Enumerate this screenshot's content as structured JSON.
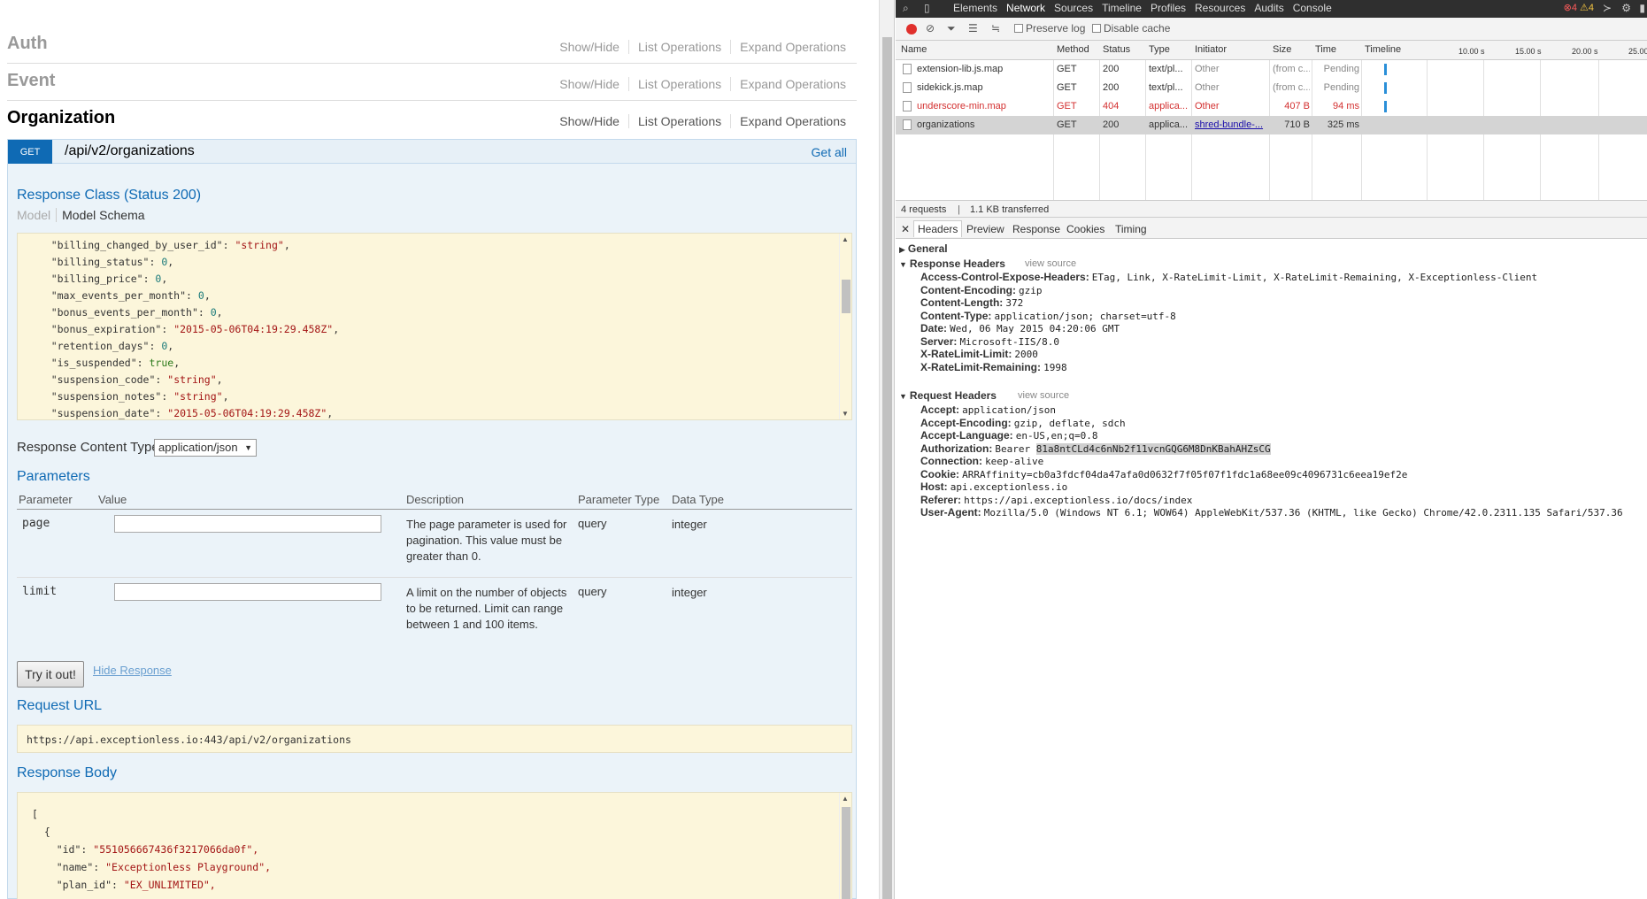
{
  "swagger": {
    "resources": [
      {
        "name": "Auth",
        "ops": [
          "Show/Hide",
          "List Operations",
          "Expand Operations"
        ]
      },
      {
        "name": "Event",
        "ops": [
          "Show/Hide",
          "List Operations",
          "Expand Operations"
        ]
      },
      {
        "name": "Organization",
        "ops": [
          "Show/Hide",
          "List Operations",
          "Expand Operations"
        ]
      }
    ],
    "operation": {
      "method": "GET",
      "path": "/api/v2/organizations",
      "summary": "Get all"
    },
    "response_class_title": "Response Class (Status 200)",
    "model_tabs": [
      "Model",
      "Model Schema"
    ],
    "schema_lines": [
      {
        "key": "\"billing_changed_by_user_id\"",
        "value": "\"string\"",
        "type": "str"
      },
      {
        "key": "\"billing_status\"",
        "value": "0",
        "type": "num"
      },
      {
        "key": "\"billing_price\"",
        "value": "0",
        "type": "num"
      },
      {
        "key": "\"max_events_per_month\"",
        "value": "0",
        "type": "num"
      },
      {
        "key": "\"bonus_events_per_month\"",
        "value": "0",
        "type": "num"
      },
      {
        "key": "\"bonus_expiration\"",
        "value": "\"2015-05-06T04:19:29.458Z\"",
        "type": "str"
      },
      {
        "key": "\"retention_days\"",
        "value": "0",
        "type": "num"
      },
      {
        "key": "\"is_suspended\"",
        "value": "true",
        "type": "bool"
      },
      {
        "key": "\"suspension_code\"",
        "value": "\"string\"",
        "type": "str"
      },
      {
        "key": "\"suspension_notes\"",
        "value": "\"string\"",
        "type": "str"
      },
      {
        "key": "\"suspension_date\"",
        "value": "\"2015-05-06T04:19:29.458Z\"",
        "type": "str"
      }
    ],
    "response_content_type_label": "Response Content Type",
    "response_content_type_value": "application/json",
    "parameters_title": "Parameters",
    "param_headers": [
      "Parameter",
      "Value",
      "Description",
      "Parameter Type",
      "Data Type"
    ],
    "params": [
      {
        "name": "page",
        "value": "",
        "description": "The page parameter is used for pagination. This value must be greater than 0.",
        "param_type": "query",
        "data_type": "integer"
      },
      {
        "name": "limit",
        "value": "",
        "description": "A limit on the number of objects to be returned. Limit can range between 1 and 100 items.",
        "param_type": "query",
        "data_type": "integer"
      }
    ],
    "try_button": "Try it out!",
    "hide_response": "Hide Response",
    "request_url_title": "Request URL",
    "request_url": "https://api.exceptionless.io:443/api/v2/organizations",
    "response_body_title": "Response Body",
    "response_body_lines": [
      {
        "indent": 0,
        "text": "["
      },
      {
        "indent": 1,
        "text": "{"
      },
      {
        "indent": 2,
        "key": "\"id\"",
        "value": "\"551056667436f3217066da0f\","
      },
      {
        "indent": 2,
        "key": "\"name\"",
        "value": "\"Exceptionless Playground\","
      },
      {
        "indent": 2,
        "key": "\"plan_id\"",
        "value": "\"EX_UNLIMITED\","
      }
    ]
  },
  "devtools": {
    "tabs": [
      "Elements",
      "Network",
      "Sources",
      "Timeline",
      "Profiles",
      "Resources",
      "Audits",
      "Console"
    ],
    "error_count": "4",
    "warning_count": "4",
    "toolbar": {
      "preserve_log": "Preserve log",
      "disable_cache": "Disable cache"
    },
    "columns": [
      "Name",
      "Method",
      "Status",
      "Type",
      "Initiator",
      "Size",
      "Time",
      "Timeline"
    ],
    "timeline_ticks": [
      "10.00 s",
      "15.00 s",
      "20.00 s",
      "25.00"
    ],
    "requests": [
      {
        "name": "extension-lib.js.map",
        "method": "GET",
        "status": "200",
        "type": "text/pl...",
        "initiator": "Other",
        "size": "(from c...",
        "time": "Pending",
        "error": false,
        "selected": false
      },
      {
        "name": "sidekick.js.map",
        "method": "GET",
        "status": "200",
        "type": "text/pl...",
        "initiator": "Other",
        "size": "(from c...",
        "time": "Pending",
        "error": false,
        "selected": false
      },
      {
        "name": "underscore-min.map",
        "method": "GET",
        "status": "404",
        "type": "applica...",
        "initiator": "Other",
        "size": "407 B",
        "time": "94 ms",
        "error": true,
        "selected": false
      },
      {
        "name": "organizations",
        "method": "GET",
        "status": "200",
        "type": "applica...",
        "initiator": "shred-bundle-...",
        "size": "710 B",
        "time": "325 ms",
        "error": false,
        "selected": true
      }
    ],
    "summary_requests": "4 requests",
    "summary_transferred": "1.1 KB transferred",
    "detail_tabs": [
      "Headers",
      "Preview",
      "Response",
      "Cookies",
      "Timing"
    ],
    "general_label": "General",
    "response_headers_label": "Response Headers",
    "request_headers_label": "Request Headers",
    "view_source": "view source",
    "response_headers": [
      {
        "k": "Access-Control-Expose-Headers:",
        "v": "ETag, Link, X-RateLimit-Limit, X-RateLimit-Remaining, X-Exceptionless-Client"
      },
      {
        "k": "Content-Encoding:",
        "v": "gzip"
      },
      {
        "k": "Content-Length:",
        "v": "372"
      },
      {
        "k": "Content-Type:",
        "v": "application/json; charset=utf-8"
      },
      {
        "k": "Date:",
        "v": "Wed, 06 May 2015 04:20:06 GMT"
      },
      {
        "k": "Server:",
        "v": "Microsoft-IIS/8.0"
      },
      {
        "k": "X-RateLimit-Limit:",
        "v": "2000"
      },
      {
        "k": "X-RateLimit-Remaining:",
        "v": "1998"
      }
    ],
    "request_headers": [
      {
        "k": "Accept:",
        "v": "application/json"
      },
      {
        "k": "Accept-Encoding:",
        "v": "gzip, deflate, sdch"
      },
      {
        "k": "Accept-Language:",
        "v": "en-US,en;q=0.8"
      },
      {
        "k": "Authorization:",
        "v": "Bearer ",
        "highlight": "81a8ntCLd4c6nNb2f11vcnGQG6M8DnKBahAHZsCG"
      },
      {
        "k": "Connection:",
        "v": "keep-alive"
      },
      {
        "k": "Cookie:",
        "v": "ARRAffinity=cb0a3fdcf04da47afa0d0632f7f05f07f1fdc1a68ee09c4096731c6eea19ef2e"
      },
      {
        "k": "Host:",
        "v": "api.exceptionless.io"
      },
      {
        "k": "Referer:",
        "v": "https://api.exceptionless.io/docs/index"
      },
      {
        "k": "User-Agent:",
        "v": "Mozilla/5.0 (Windows NT 6.1; WOW64) AppleWebKit/537.36 (KHTML, like Gecko) Chrome/42.0.2311.135 Safari/537.36"
      }
    ]
  }
}
